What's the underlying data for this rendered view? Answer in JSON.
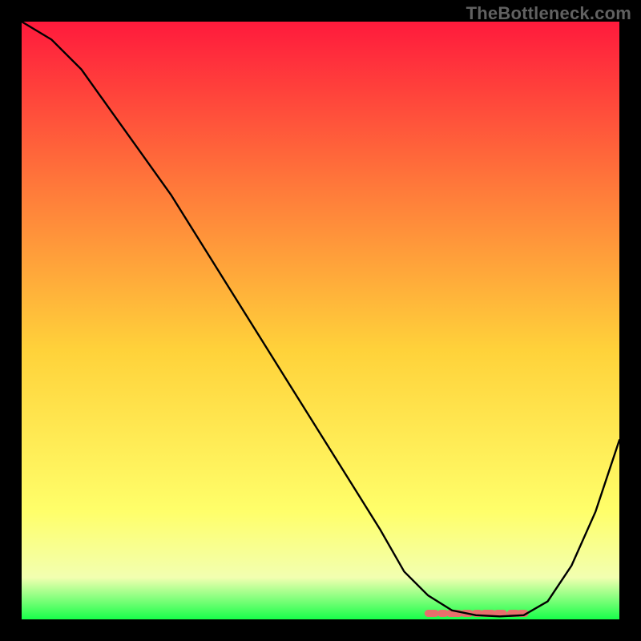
{
  "watermark": "TheBottleneck.com",
  "colors": {
    "grad_top": "#ff1a3c",
    "grad_mid_up": "#ff7a3a",
    "grad_mid": "#ffd23a",
    "grad_low": "#ffff6a",
    "grad_pale": "#f2ffb0",
    "grad_bottom": "#18ff4a",
    "marker": "#e86f6c",
    "curve": "#000000"
  },
  "chart_data": {
    "type": "line",
    "title": "",
    "xlabel": "",
    "ylabel": "",
    "xlim": [
      0,
      100
    ],
    "ylim": [
      0,
      100
    ],
    "x": [
      0,
      5,
      10,
      15,
      20,
      25,
      30,
      35,
      40,
      45,
      50,
      55,
      60,
      64,
      68,
      72,
      76,
      80,
      84,
      88,
      92,
      96,
      100
    ],
    "values": [
      100,
      97,
      92,
      85,
      78,
      71,
      63,
      55,
      47,
      39,
      31,
      23,
      15,
      8,
      4,
      1.5,
      0.7,
      0.5,
      0.7,
      3,
      9,
      18,
      30
    ],
    "marker_band": {
      "x_start": 68,
      "x_end": 85,
      "y": 0.6
    },
    "gradient_stops": [
      {
        "offset": 0.0,
        "key": "grad_top"
      },
      {
        "offset": 0.28,
        "key": "grad_mid_up"
      },
      {
        "offset": 0.55,
        "key": "grad_mid"
      },
      {
        "offset": 0.82,
        "key": "grad_low"
      },
      {
        "offset": 0.93,
        "key": "grad_pale"
      },
      {
        "offset": 1.0,
        "key": "grad_bottom"
      }
    ]
  }
}
